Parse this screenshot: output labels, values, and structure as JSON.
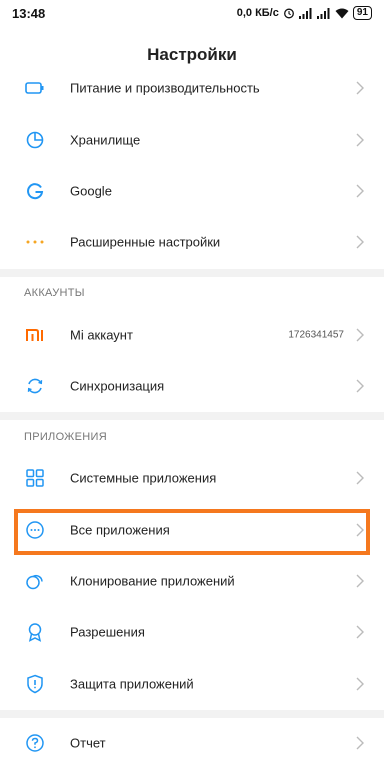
{
  "status_bar": {
    "time": "13:48",
    "network_speed": "0,0 КБ/с",
    "battery": "91"
  },
  "header": {
    "title": "Настройки"
  },
  "items_top": [
    {
      "label": "Питание и производительность",
      "icon": "battery-icon"
    },
    {
      "label": "Хранилище",
      "icon": "pie-chart-icon"
    },
    {
      "label": "Google",
      "icon": "google-g-icon"
    },
    {
      "label": "Расширенные настройки",
      "icon": "more-dots-icon"
    }
  ],
  "accounts": {
    "header": "АККАУНТЫ",
    "items": [
      {
        "label": "Mi аккаунт",
        "value": "1726341457",
        "icon": "mi-logo-icon"
      },
      {
        "label": "Синхронизация",
        "icon": "sync-icon"
      }
    ]
  },
  "apps": {
    "header": "ПРИЛОЖЕНИЯ",
    "items": [
      {
        "label": "Системные приложения",
        "icon": "grid-icon"
      },
      {
        "label": "Все приложения",
        "icon": "more-circle-icon"
      },
      {
        "label": "Клонирование приложений",
        "icon": "clone-icon"
      },
      {
        "label": "Разрешения",
        "icon": "permission-badge-icon"
      },
      {
        "label": "Защита приложений",
        "icon": "shield-icon"
      }
    ]
  },
  "items_bottom": [
    {
      "label": "Отчет",
      "icon": "help-circle-icon"
    }
  ],
  "colors": {
    "accent": "#2196f3",
    "mi_orange": "#ff6a00",
    "highlight": "#f5781e",
    "divider": "#f2f2f2"
  }
}
